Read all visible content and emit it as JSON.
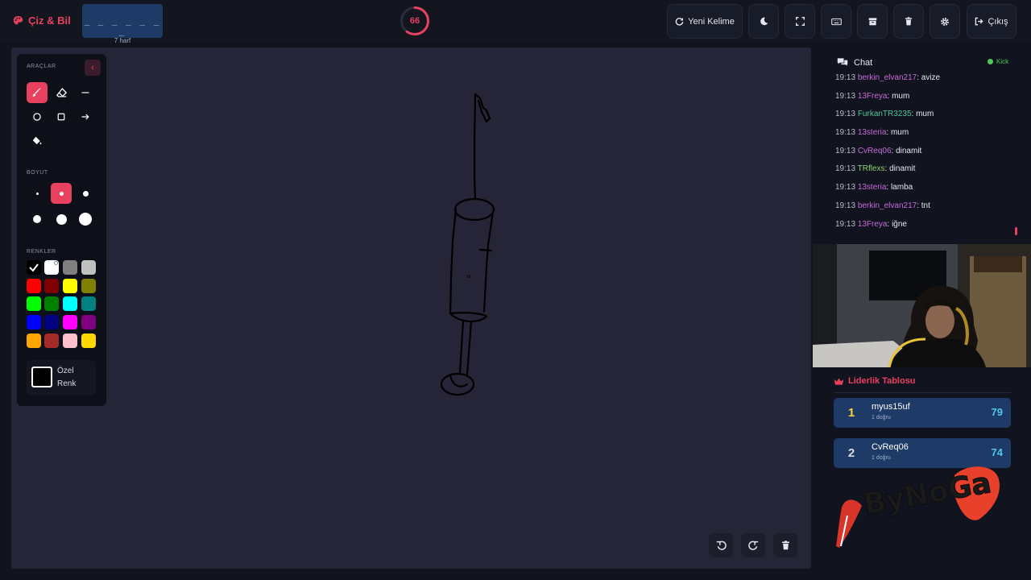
{
  "app": {
    "title": "Çiz & Bil"
  },
  "word": {
    "dashes": "_ _ _ _ _ _ _",
    "hint": "7 harf"
  },
  "timer": {
    "value": "66",
    "progress": 0.6
  },
  "toolbar": {
    "new_word_label": "Yeni Kelime",
    "exit_label": "Çıkış",
    "icons": [
      "refresh-icon",
      "moon-icon",
      "fullscreen-icon",
      "keyboard-icon",
      "archive-icon",
      "trash-icon",
      "gear-icon",
      "logout-icon"
    ]
  },
  "tools": {
    "section_label": "ARAÇLAR",
    "size_label": "BOYUT",
    "colors_label": "RENKLER",
    "custom_color_label_1": "Özel",
    "custom_color_label_2": "Renk",
    "swatches": [
      "#000000",
      "#ffffff",
      "#808080",
      "#c0c0c0",
      "#ff0000",
      "#800000",
      "#ffff00",
      "#808000",
      "#00ff00",
      "#008000",
      "#00ffff",
      "#008080",
      "#0000ff",
      "#000080",
      "#ff00ff",
      "#800080",
      "#ffa500",
      "#a52a2a",
      "#ffc0cb",
      "#ffd700"
    ]
  },
  "chat": {
    "title": "Chat",
    "platform": "Kick",
    "messages": [
      {
        "time": "19:13",
        "user": "berkin_elvan217",
        "color": "#c76bd9",
        "text": "avize"
      },
      {
        "time": "19:13",
        "user": "13Freya",
        "color": "#c76bd9",
        "text": "mum"
      },
      {
        "time": "19:13",
        "user": "FurkanTR3235",
        "color": "#4fc896",
        "text": "mum"
      },
      {
        "time": "19:13",
        "user": "13steria",
        "color": "#c76bd9",
        "text": "mum"
      },
      {
        "time": "19:13",
        "user": "CvReq06",
        "color": "#c76bd9",
        "text": "dinamit"
      },
      {
        "time": "19:13",
        "user": "TRflexs",
        "color": "#8fd46b",
        "text": "dinamit"
      },
      {
        "time": "19:13",
        "user": "13steria",
        "color": "#c76bd9",
        "text": "lamba"
      },
      {
        "time": "19:13",
        "user": "berkin_elvan217",
        "color": "#c76bd9",
        "text": "tnt"
      },
      {
        "time": "19:13",
        "user": "13Freya",
        "color": "#c76bd9",
        "text": "iğne"
      }
    ]
  },
  "leaderboard": {
    "title": "Liderlik Tablosu",
    "rows": [
      {
        "rank": "1",
        "name": "myus15uf",
        "sub": "1 doğru",
        "score": "79",
        "rank_color": "#f5d442"
      },
      {
        "rank": "2",
        "name": "CvReq06",
        "sub": "1 doğru",
        "score": "74",
        "rank_color": "#d8dbe6"
      }
    ]
  },
  "overlay": {
    "text": "ByNoGa"
  },
  "colors": {
    "accent": "#e8405f",
    "panel": "#1e3a66",
    "canvas": "#262537",
    "score": "#4fc8ef"
  }
}
